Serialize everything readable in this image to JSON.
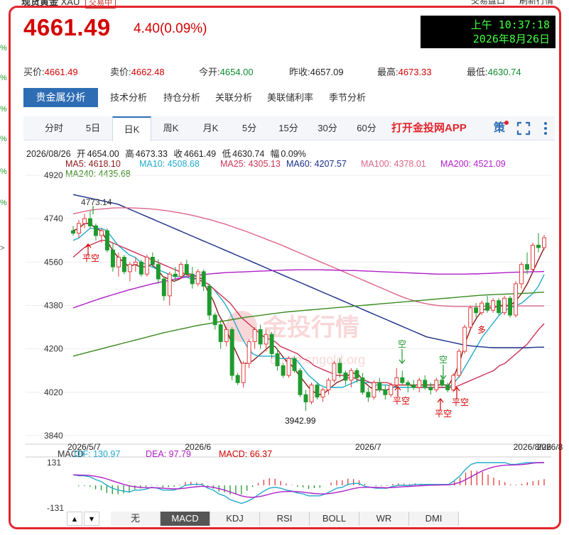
{
  "header": {
    "name_cut": "现货黄金",
    "code_cut": "XAU",
    "tag_cut": "交易中",
    "right_cut_1": "交易盘口",
    "right_cut_2": "刷新行情",
    "price": "4661.49",
    "change": "4.40(0.09%)",
    "clock_line1": "上午 10:37:18",
    "clock_line2": "2026年8月26日"
  },
  "left_edge": [
    "%",
    "%",
    "%",
    "%",
    "%",
    "%",
    ">"
  ],
  "quotes": [
    {
      "label": "买价:",
      "value": "4661.49",
      "color": "red"
    },
    {
      "label": "卖价:",
      "value": "4662.48",
      "color": "red"
    },
    {
      "label": "今开:",
      "value": "4654.00",
      "color": "green"
    },
    {
      "label": "昨收:",
      "value": "4657.09",
      "color": "black"
    },
    {
      "label": "最高:",
      "value": "4673.33",
      "color": "red"
    },
    {
      "label": "最低:",
      "value": "4630.74",
      "color": "green"
    }
  ],
  "tabs": {
    "active": "贵金属分析",
    "items": [
      "技术分析",
      "持仓分析",
      "关联分析",
      "美联储利率",
      "季节分析"
    ]
  },
  "periods": [
    "分时",
    "5日",
    "日K",
    "周K",
    "月K",
    "5分",
    "15分",
    "30分",
    "60分"
  ],
  "active_period": "日K",
  "app_link": "打开金投网APP",
  "icons": {
    "strategy": "策",
    "fullscreen": "fullscreen-icon",
    "more": "more-icon"
  },
  "ohlc_info": {
    "date": "2026/08/26",
    "open_label": "开",
    "open": "4654.00",
    "high_label": "高",
    "high": "4673.33",
    "close_label": "收",
    "close": "4661.49",
    "low_label": "低",
    "low": "4630.74",
    "amp_label": "幅",
    "amp": "0.09%"
  },
  "ma_labels": [
    {
      "text": "MA5: 4618.10",
      "color": "#8b1a1a"
    },
    {
      "text": "MA10: 4508.68",
      "color": "#22aacc"
    },
    {
      "text": "MA25: 4305.13",
      "color": "#cc3355"
    },
    {
      "text": "MA60: 4207.57",
      "color": "#1a2e8a"
    },
    {
      "text": "MA100: 4378.01",
      "color": "#dd6688"
    },
    {
      "text": "MA200: 4521.09",
      "color": "#b01ec8"
    },
    {
      "text": "MA240: 4435.68",
      "color": "#3a8a1e"
    }
  ],
  "watermark": {
    "main": "金投行情",
    "sub": "quote.cngold.org"
  },
  "chart_data": {
    "type": "candlestick",
    "y_ticks": [
      3840,
      4020,
      4200,
      4380,
      4560,
      4740,
      4920
    ],
    "ylim": [
      3840,
      4920
    ],
    "x_ticks": [
      "2026/5/7",
      "2026/6",
      "2026/7",
      "2026/8",
      "2026/8/26"
    ],
    "annotations": [
      {
        "text": "4773.14",
        "type": "high"
      },
      {
        "text": "3942.99",
        "type": "low"
      },
      {
        "text": "平空"
      },
      {
        "text": "空"
      },
      {
        "text": "平空"
      },
      {
        "text": "空"
      },
      {
        "text": "平空"
      },
      {
        "text": "平空"
      },
      {
        "text": "多"
      }
    ],
    "candles_approx": [
      [
        4690,
        4710,
        4670,
        4680
      ],
      [
        4680,
        4735,
        4660,
        4720
      ],
      [
        4720,
        4760,
        4700,
        4740
      ],
      [
        4740,
        4773,
        4700,
        4710
      ],
      [
        4710,
        4720,
        4650,
        4670
      ],
      [
        4670,
        4700,
        4640,
        4690
      ],
      [
        4690,
        4700,
        4600,
        4610
      ],
      [
        4610,
        4640,
        4520,
        4540
      ],
      [
        4540,
        4600,
        4500,
        4580
      ],
      [
        4580,
        4590,
        4510,
        4520
      ],
      [
        4520,
        4560,
        4480,
        4550
      ],
      [
        4550,
        4580,
        4520,
        4560
      ],
      [
        4560,
        4570,
        4500,
        4510
      ],
      [
        4510,
        4590,
        4500,
        4580
      ],
      [
        4580,
        4600,
        4540,
        4550
      ],
      [
        4550,
        4570,
        4470,
        4490
      ],
      [
        4490,
        4500,
        4400,
        4420
      ],
      [
        4420,
        4520,
        4380,
        4510
      ],
      [
        4510,
        4540,
        4480,
        4500
      ],
      [
        4500,
        4560,
        4490,
        4550
      ],
      [
        4550,
        4570,
        4500,
        4510
      ],
      [
        4510,
        4540,
        4450,
        4470
      ],
      [
        4470,
        4530,
        4460,
        4520
      ],
      [
        4520,
        4530,
        4440,
        4460
      ],
      [
        4460,
        4470,
        4320,
        4340
      ],
      [
        4340,
        4350,
        4280,
        4300
      ],
      [
        4300,
        4320,
        4200,
        4230
      ],
      [
        4230,
        4290,
        4210,
        4280
      ],
      [
        4280,
        4290,
        4070,
        4090
      ],
      [
        4090,
        4100,
        4050,
        4060
      ],
      [
        4060,
        4150,
        4040,
        4140
      ],
      [
        4140,
        4240,
        4120,
        4230
      ],
      [
        4230,
        4290,
        4200,
        4280
      ],
      [
        4280,
        4300,
        4200,
        4220
      ],
      [
        4220,
        4280,
        4190,
        4260
      ],
      [
        4260,
        4270,
        4160,
        4180
      ],
      [
        4180,
        4200,
        4110,
        4130
      ],
      [
        4130,
        4140,
        4080,
        4090
      ],
      [
        4090,
        4170,
        4080,
        4160
      ],
      [
        4160,
        4170,
        4100,
        4110
      ],
      [
        4110,
        4120,
        4000,
        4010
      ],
      [
        4010,
        4030,
        3942,
        3980
      ],
      [
        3980,
        4060,
        3970,
        4050
      ],
      [
        4050,
        4060,
        3990,
        4000
      ],
      [
        4000,
        4040,
        3980,
        4030
      ],
      [
        4030,
        4080,
        4010,
        4070
      ],
      [
        4070,
        4150,
        4060,
        4140
      ],
      [
        4140,
        4160,
        4080,
        4100
      ],
      [
        4100,
        4110,
        4050,
        4070
      ],
      [
        4070,
        4120,
        4040,
        4110
      ],
      [
        4110,
        4120,
        4060,
        4080
      ],
      [
        4080,
        4100,
        4010,
        4020
      ],
      [
        4020,
        4040,
        3980,
        4000
      ],
      [
        4000,
        4070,
        3990,
        4060
      ],
      [
        4060,
        4080,
        4020,
        4030
      ],
      [
        4030,
        4050,
        3990,
        4010
      ],
      [
        4010,
        4060,
        4000,
        4050
      ],
      [
        4050,
        4120,
        4040,
        4080
      ],
      [
        4080,
        4110,
        4050,
        4060
      ],
      [
        4060,
        4070,
        4020,
        4050
      ],
      [
        4050,
        4070,
        4030,
        4040
      ],
      [
        4040,
        4080,
        4020,
        4070
      ],
      [
        4070,
        4090,
        4030,
        4040
      ],
      [
        4040,
        4060,
        4010,
        4030
      ],
      [
        4030,
        4080,
        4020,
        4070
      ],
      [
        4070,
        4090,
        4040,
        4050
      ],
      [
        4050,
        4060,
        4020,
        4030
      ],
      [
        4030,
        4100,
        4020,
        4090
      ],
      [
        4090,
        4200,
        4080,
        4190
      ],
      [
        4190,
        4300,
        4180,
        4290
      ],
      [
        4290,
        4380,
        4280,
        4370
      ],
      [
        4370,
        4390,
        4330,
        4350
      ],
      [
        4350,
        4400,
        4340,
        4390
      ],
      [
        4390,
        4420,
        4350,
        4360
      ],
      [
        4360,
        4410,
        4350,
        4400
      ],
      [
        4400,
        4410,
        4340,
        4350
      ],
      [
        4350,
        4420,
        4340,
        4410
      ],
      [
        4410,
        4420,
        4330,
        4340
      ],
      [
        4340,
        4480,
        4330,
        4470
      ],
      [
        4470,
        4560,
        4450,
        4550
      ],
      [
        4550,
        4600,
        4510,
        4530
      ],
      [
        4530,
        4640,
        4520,
        4630
      ],
      [
        4630,
        4680,
        4600,
        4620
      ],
      [
        4620,
        4673,
        4610,
        4661
      ]
    ],
    "ma_series_approx": [
      {
        "name": "MA5",
        "color": "#8b1a1a",
        "values": [
          4690,
          4700,
          4720,
          4720,
          4700,
          4690,
          4650,
          4610,
          4580,
          4560,
          4540,
          4550,
          4540,
          4540,
          4550,
          4530,
          4500,
          4490,
          4480,
          4490,
          4510,
          4510,
          4500,
          4490,
          4440,
          4400,
          4340,
          4300,
          4240,
          4190,
          4140,
          4140,
          4150,
          4170,
          4190,
          4210,
          4210,
          4180,
          4150,
          4130,
          4100,
          4070,
          4040,
          4020,
          4010,
          4020,
          4040,
          4060,
          4070,
          4090,
          4100,
          4090,
          4060,
          4040,
          4030,
          4030,
          4030,
          4040,
          4050,
          4050,
          4050,
          4050,
          4050,
          4050,
          4050,
          4050,
          4050,
          4050,
          4090,
          4150,
          4230,
          4290,
          4330,
          4360,
          4370,
          4370,
          4380,
          4380,
          4380,
          4400,
          4430,
          4470,
          4520,
          4570,
          4618
        ]
      },
      {
        "name": "MA10",
        "color": "#22aacc",
        "values": [
          4650,
          4660,
          4680,
          4700,
          4700,
          4700,
          4690,
          4660,
          4630,
          4610,
          4590,
          4580,
          4560,
          4550,
          4540,
          4530,
          4520,
          4510,
          4500,
          4500,
          4500,
          4490,
          4490,
          4480,
          4470,
          4450,
          4420,
          4390,
          4350,
          4300,
          4250,
          4210,
          4180,
          4170,
          4170,
          4170,
          4170,
          4160,
          4160,
          4160,
          4150,
          4120,
          4090,
          4070,
          4050,
          4040,
          4040,
          4040,
          4040,
          4050,
          4060,
          4070,
          4060,
          4060,
          4050,
          4050,
          4050,
          4040,
          4040,
          4040,
          4040,
          4040,
          4040,
          4040,
          4040,
          4040,
          4040,
          4040,
          4060,
          4090,
          4130,
          4170,
          4210,
          4250,
          4280,
          4310,
          4340,
          4360,
          4370,
          4380,
          4390,
          4410,
          4430,
          4460,
          4508
        ]
      },
      {
        "name": "MA25",
        "color": "#cc3355",
        "values": [
          4580,
          4600,
          4620,
          4630,
          4640,
          4650,
          4650,
          4640,
          4630,
          4620,
          4610,
          4600,
          4590,
          4580,
          4570,
          4560,
          4550,
          4540,
          4530,
          4520,
          4510,
          4500,
          4490,
          4480,
          4470,
          4450,
          4430,
          4410,
          4390,
          4360,
          4330,
          4310,
          4290,
          4270,
          4250,
          4240,
          4230,
          4210,
          4200,
          4190,
          4180,
          4160,
          4150,
          4130,
          4120,
          4110,
          4100,
          4090,
          4090,
          4080,
          4080,
          4070,
          4070,
          4060,
          4060,
          4060,
          4060,
          4050,
          4050,
          4050,
          4050,
          4040,
          4040,
          4040,
          4040,
          4040,
          4040,
          4040,
          4040,
          4050,
          4060,
          4070,
          4080,
          4090,
          4100,
          4110,
          4130,
          4140,
          4160,
          4180,
          4200,
          4220,
          4250,
          4280,
          4305
        ]
      },
      {
        "name": "MA60",
        "color": "#1a2e8a",
        "values": [
          4840,
          4835,
          4830,
          4825,
          4820,
          4815,
          4810,
          4805,
          4800,
          4790,
          4780,
          4770,
          4760,
          4750,
          4740,
          4730,
          4720,
          4710,
          4700,
          4690,
          4680,
          4670,
          4660,
          4650,
          4640,
          4630,
          4620,
          4610,
          4600,
          4590,
          4580,
          4570,
          4560,
          4550,
          4540,
          4530,
          4520,
          4510,
          4500,
          4490,
          4480,
          4470,
          4460,
          4450,
          4440,
          4430,
          4420,
          4410,
          4400,
          4390,
          4380,
          4370,
          4360,
          4350,
          4340,
          4330,
          4320,
          4310,
          4300,
          4290,
          4280,
          4270,
          4260,
          4250,
          4245,
          4240,
          4235,
          4230,
          4225,
          4220,
          4215,
          4212,
          4210,
          4208,
          4206,
          4205,
          4205,
          4205,
          4205,
          4205,
          4205,
          4205,
          4206,
          4207,
          4207
        ]
      },
      {
        "name": "MA100",
        "color": "#dd6688",
        "values": [
          4760,
          4765,
          4770,
          4775,
          4778,
          4780,
          4782,
          4784,
          4785,
          4785,
          4785,
          4784,
          4783,
          4782,
          4780,
          4778,
          4775,
          4772,
          4768,
          4764,
          4760,
          4755,
          4750,
          4744,
          4738,
          4732,
          4725,
          4718,
          4710,
          4702,
          4694,
          4686,
          4677,
          4668,
          4659,
          4650,
          4641,
          4632,
          4622,
          4612,
          4602,
          4592,
          4582,
          4572,
          4562,
          4552,
          4542,
          4532,
          4522,
          4512,
          4502,
          4492,
          4482,
          4472,
          4462,
          4452,
          4442,
          4432,
          4422,
          4413,
          4405,
          4398,
          4392,
          4387,
          4383,
          4380,
          4378,
          4377,
          4376,
          4376,
          4376,
          4376,
          4376,
          4377,
          4377,
          4377,
          4377,
          4377,
          4378,
          4378,
          4378,
          4378,
          4378,
          4378,
          4378
        ]
      },
      {
        "name": "MA200",
        "color": "#b01ec8",
        "values": [
          4370,
          4378,
          4386,
          4394,
          4402,
          4410,
          4417,
          4424,
          4431,
          4438,
          4445,
          4451,
          4457,
          4463,
          4469,
          4474,
          4479,
          4484,
          4489,
          4493,
          4497,
          4501,
          4504,
          4507,
          4510,
          4512,
          4514,
          4516,
          4517,
          4518,
          4519,
          4520,
          4521,
          4522,
          4523,
          4524,
          4525,
          4526,
          4527,
          4527,
          4528,
          4528,
          4528,
          4528,
          4528,
          4527,
          4527,
          4526,
          4526,
          4525,
          4525,
          4524,
          4523,
          4522,
          4521,
          4520,
          4519,
          4518,
          4517,
          4516,
          4515,
          4514,
          4513,
          4512,
          4511,
          4510,
          4510,
          4510,
          4510,
          4510,
          4510,
          4511,
          4511,
          4512,
          4513,
          4514,
          4515,
          4516,
          4517,
          4518,
          4518,
          4519,
          4520,
          4520,
          4521
        ]
      },
      {
        "name": "MA240",
        "color": "#3a8a1e",
        "values": [
          4170,
          4176,
          4182,
          4188,
          4194,
          4200,
          4206,
          4212,
          4218,
          4224,
          4230,
          4236,
          4242,
          4248,
          4254,
          4260,
          4266,
          4271,
          4276,
          4281,
          4286,
          4291,
          4296,
          4300,
          4304,
          4308,
          4312,
          4316,
          4320,
          4324,
          4328,
          4332,
          4335,
          4338,
          4341,
          4344,
          4347,
          4350,
          4353,
          4355,
          4357,
          4359,
          4361,
          4363,
          4365,
          4367,
          4369,
          4371,
          4373,
          4375,
          4377,
          4379,
          4381,
          4383,
          4385,
          4387,
          4389,
          4391,
          4393,
          4395,
          4397,
          4399,
          4401,
          4403,
          4405,
          4407,
          4409,
          4411,
          4413,
          4415,
          4417,
          4419,
          4421,
          4423,
          4424,
          4425,
          4426,
          4427,
          4428,
          4429,
          4430,
          4431,
          4432,
          4434,
          4435
        ]
      }
    ],
    "macd": {
      "labels": [
        {
          "text": "MACD",
          "color": "#333"
        },
        {
          "text": "DIF: 130.97",
          "color": "#22aacc"
        },
        {
          "text": "DEA: 97.79",
          "color": "#b01ec8"
        },
        {
          "text": "MACD: 66.37",
          "color": "#d40000"
        }
      ],
      "y_ticks": [
        "131",
        "-131"
      ],
      "ylim": [
        -131,
        131
      ]
    }
  },
  "indicator_buttons": [
    "无",
    "MACD",
    "KDJ",
    "RSI",
    "BOLL",
    "WR",
    "DMI"
  ],
  "active_indicator": "MACD",
  "nav_arrows": [
    "▲",
    "▼"
  ]
}
